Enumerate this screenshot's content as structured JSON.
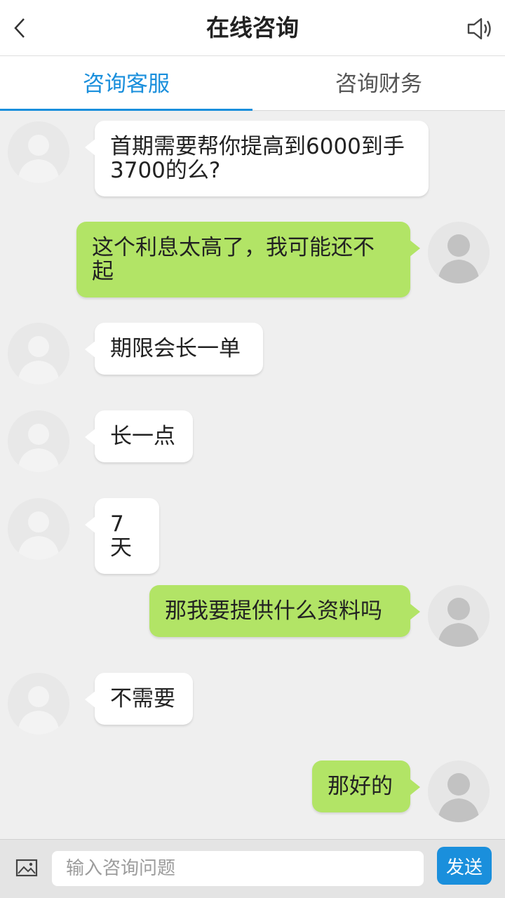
{
  "header": {
    "title": "在线咨询",
    "back_icon": "chevron-left-icon",
    "speaker_icon": "speaker-icon"
  },
  "tabs": [
    {
      "label": "咨询客服",
      "active": true
    },
    {
      "label": "咨询财务",
      "active": false
    }
  ],
  "messages": [
    {
      "side": "left",
      "text": "首期需要帮你提高到6000到手3700的么?"
    },
    {
      "side": "right",
      "text": "这个利息太高了，我可能还不起"
    },
    {
      "side": "left",
      "text": "期限会长一单"
    },
    {
      "side": "left",
      "text": "长一点"
    },
    {
      "side": "left",
      "text": "7天"
    },
    {
      "side": "right",
      "text": "那我要提供什么资料吗"
    },
    {
      "side": "left",
      "text": "不需要"
    },
    {
      "side": "right",
      "text": "那好的"
    }
  ],
  "footer": {
    "image_icon": "image-icon",
    "input_placeholder": "输入咨询问题",
    "input_value": "",
    "send_label": "发送"
  },
  "colors": {
    "accent": "#1a8fdc",
    "outgoing_bubble": "#b2e466",
    "incoming_bubble": "#ffffff",
    "background": "#efefef"
  }
}
